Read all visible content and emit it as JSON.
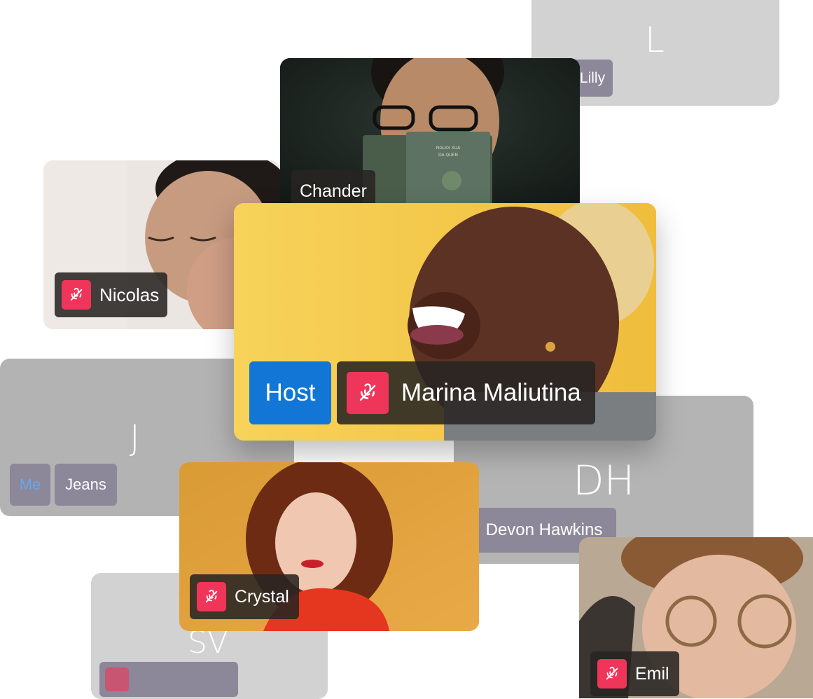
{
  "participants": {
    "lilly": {
      "initial": "L",
      "name": "Lilly"
    },
    "chander": {
      "name": "Chander"
    },
    "nicolas": {
      "name": "Nicolas",
      "muted": true
    },
    "marina": {
      "badge": "Host",
      "name": "Marina Maliutina",
      "muted": true
    },
    "jeans": {
      "initial": "J",
      "me_badge": "Me",
      "name": "Jeans"
    },
    "devon": {
      "initials": "DH",
      "name": "Devon Hawkins"
    },
    "crystal": {
      "name": "Crystal",
      "muted": true
    },
    "sv": {
      "initials": "SV"
    },
    "emil": {
      "name": "Emil",
      "muted": true
    }
  },
  "colors": {
    "host_badge": "#1276d6",
    "mic_muted": "#f0355a",
    "me_text": "#6aa6e6",
    "name_pill_purple": "#8c8799"
  },
  "icons": {
    "muted": "microphone-off-icon"
  }
}
